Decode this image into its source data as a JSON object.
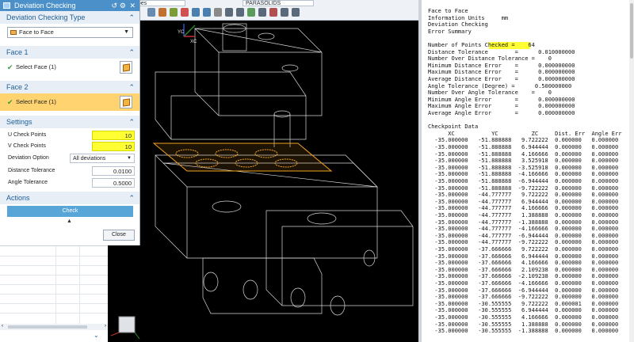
{
  "toolbar": {
    "sel1": "apes",
    "sel2": "PARASOLIDS"
  },
  "dialog": {
    "title": "Deviation Checking",
    "sections": {
      "type": "Deviation Checking Type",
      "face1": "Face 1",
      "face2": "Face 2",
      "settings": "Settings",
      "actions": "Actions"
    },
    "type_value": "Face to Face",
    "face1_select": "Select Face (1)",
    "face2_select": "Select Face (1)",
    "settings": {
      "u_label": "U Check Points",
      "u_value": "10",
      "v_label": "V Check Points",
      "v_value": "10",
      "option_label": "Deviation Option",
      "option_value": "All deviations",
      "dist_label": "Distance Tolerance",
      "dist_value": "0.0100",
      "angle_label": "Angle Tolerance",
      "angle_value": "0.5000"
    },
    "check_button": "Check",
    "close_button": "Close"
  },
  "viewport": {
    "triad_labels": [
      "YC",
      "XC"
    ]
  },
  "info": {
    "lines": [
      "Face to Face",
      "Information Units     mm",
      "Deviation Checking",
      "Error Summary",
      "",
      "Number of Points Checked =    64",
      "Distance Tolerance        =      0.010000000",
      "Number Over Distance Tolerance =    0",
      "Minimum Distance Error    =      0.000000000",
      "Maximum Distance Error    =      0.000000000",
      "Average Distance Error    =      0.000000000",
      "Angle Tolerance (Degree) =      0.500000000",
      "Number Over Angle Tolerance    =    0",
      "Minimum Angle Error       =      0.000000000",
      "Maximum Angle Error       =      0.000000000",
      "Average Angle Error       =      0.000000000",
      "",
      "Checkpoint Data",
      "      XC           YC          ZC     Dist. Err  Angle Err",
      "  -35.000000   -51.888888   9.722222  0.000000   0.000000",
      "  -35.000000   -51.888888   6.944444  0.000000   0.000000",
      "  -35.000000   -51.888888   4.166666  0.000000   0.000000",
      "  -35.000000   -51.888888   3.525918  0.000000   0.000000",
      "  -35.000000   -51.888888  -3.525918  0.000000   0.000000",
      "  -35.000000   -51.888888  -4.166666  0.000000   0.000000",
      "  -35.000000   -51.888888  -6.944444  0.000000   0.000000",
      "  -35.000000   -51.888888  -9.722222  0.000000   0.000000",
      "  -35.000000   -44.777777   9.722222  0.000000   0.000000",
      "  -35.000000   -44.777777   6.944444  0.000000   0.000000",
      "  -35.000000   -44.777777   4.166666  0.000000   0.000000",
      "  -35.000000   -44.777777   1.388888  0.000000   0.000000",
      "  -35.000000   -44.777777  -1.388888  0.000000   0.000000",
      "  -35.000000   -44.777777  -4.166666  0.000000   0.000000",
      "  -35.000000   -44.777777  -6.944444  0.000000   0.000000",
      "  -35.000000   -44.777777  -9.722222  0.000000   0.000000",
      "  -35.000000   -37.666666   9.722222  0.000000   0.000000",
      "  -35.000000   -37.666666   6.944444  0.000000   0.000000",
      "  -35.000000   -37.666666   4.166666  0.000000   0.000000",
      "  -35.000000   -37.666666   2.109238  0.000000   0.000000",
      "  -35.000000   -37.666666  -2.109238  0.000000   0.000000",
      "  -35.000000   -37.666666  -4.166666  0.000000   0.000000",
      "  -35.000000   -37.666666  -6.944444  0.000000   0.000000",
      "  -35.000000   -37.666666  -9.722222  0.000000   0.000000",
      "  -35.000000   -30.555555   9.722222  0.000001   0.000000",
      "  -35.000000   -30.555555   6.944444  0.000000   0.000000",
      "  -35.000000   -30.555555   4.166666  0.000000   0.000000",
      "  -35.000000   -30.555555   1.388888  0.000000   0.000000",
      "  -35.000000   -30.555555  -1.388888  0.000000   0.000000"
    ]
  }
}
